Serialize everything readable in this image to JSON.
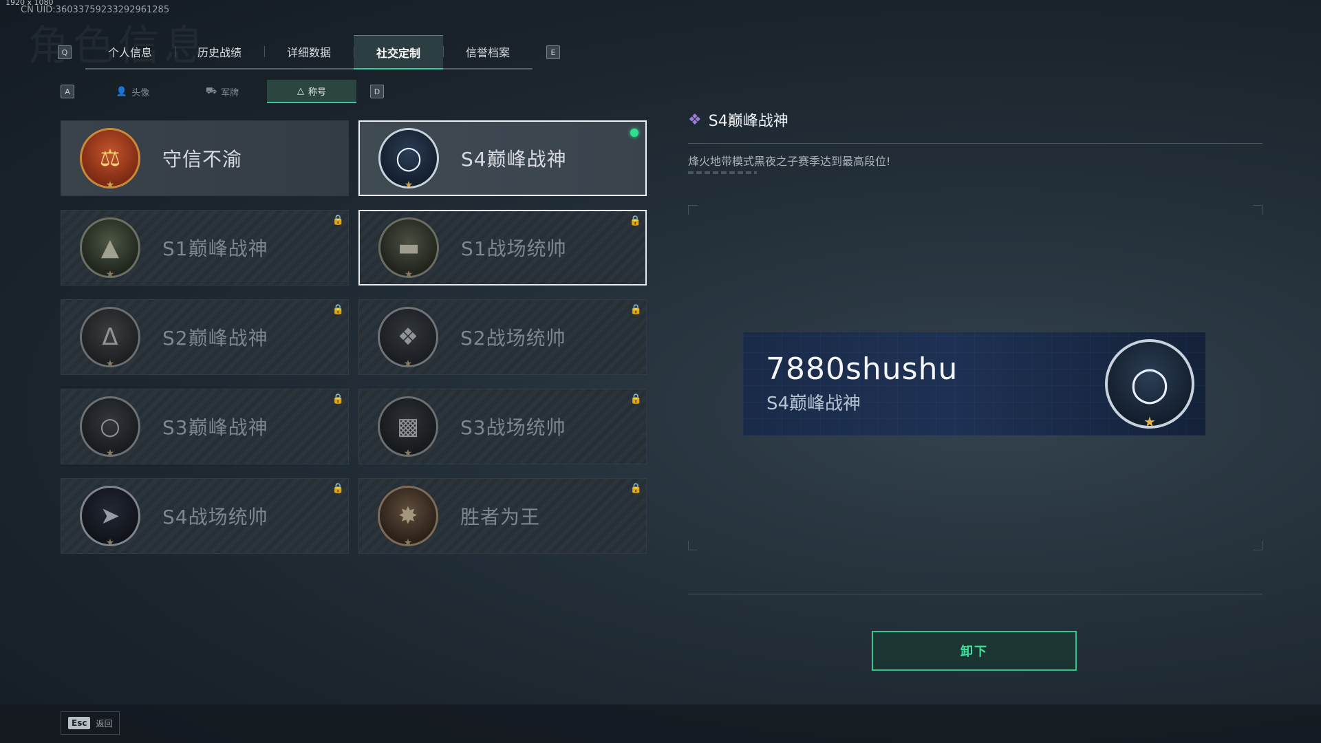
{
  "header": {
    "dims": "1920 x 1080",
    "uid": "CN UID:3603375923329296‌1285",
    "watermark": "角色信息"
  },
  "tabs": {
    "left_key": "Q",
    "right_key": "E",
    "items": [
      "个人信息",
      "历史战绩",
      "详细数据",
      "社交定制",
      "信誉档案"
    ],
    "active_index": 3
  },
  "subtabs": {
    "left_key": "A",
    "right_key": "D",
    "items": [
      {
        "label": "头像",
        "icon": "person-icon"
      },
      {
        "label": "军牌",
        "icon": "dogtag-icon"
      },
      {
        "label": "称号",
        "icon": "triangle-icon"
      }
    ],
    "active_index": 2
  },
  "titles": [
    {
      "name": "守信不渝",
      "icon": "scales-icon",
      "locked": false
    },
    {
      "name": "S4巅峰战神",
      "icon": "nvg-helmet-icon",
      "locked": false,
      "selected": true,
      "equipped": true
    },
    {
      "name": "S1巅峰战神",
      "icon": "crocodile-icon",
      "locked": true
    },
    {
      "name": "S1战场统帅",
      "icon": "tank-icon",
      "locked": true,
      "outlined": true
    },
    {
      "name": "S2巅峰战神",
      "icon": "delta-icon",
      "locked": true
    },
    {
      "name": "S2战场统帅",
      "icon": "helicopter-icon",
      "locked": true
    },
    {
      "name": "S3巅峰战神",
      "icon": "globe-icon",
      "locked": true
    },
    {
      "name": "S3战场统帅",
      "icon": "apc-icon",
      "locked": true
    },
    {
      "name": "S4战场统帅",
      "icon": "missile-icon",
      "locked": true
    },
    {
      "name": "胜者为王",
      "icon": "medal-icon",
      "locked": true
    }
  ],
  "detail": {
    "title": "S4巅峰战神",
    "description": "烽火地带模式黑夜之子赛季达到最高段位!",
    "diamond_color": "#9b7ed9"
  },
  "preview": {
    "player_name": "7880shushu",
    "title": "S4巅峰战神"
  },
  "actions": {
    "unequip": "卸下"
  },
  "footer": {
    "esc_key": "Esc",
    "esc_label": "返回"
  },
  "colors": {
    "accent": "#3ec598",
    "equipped": "#2fe08f",
    "button_text": "#3fe19d"
  }
}
